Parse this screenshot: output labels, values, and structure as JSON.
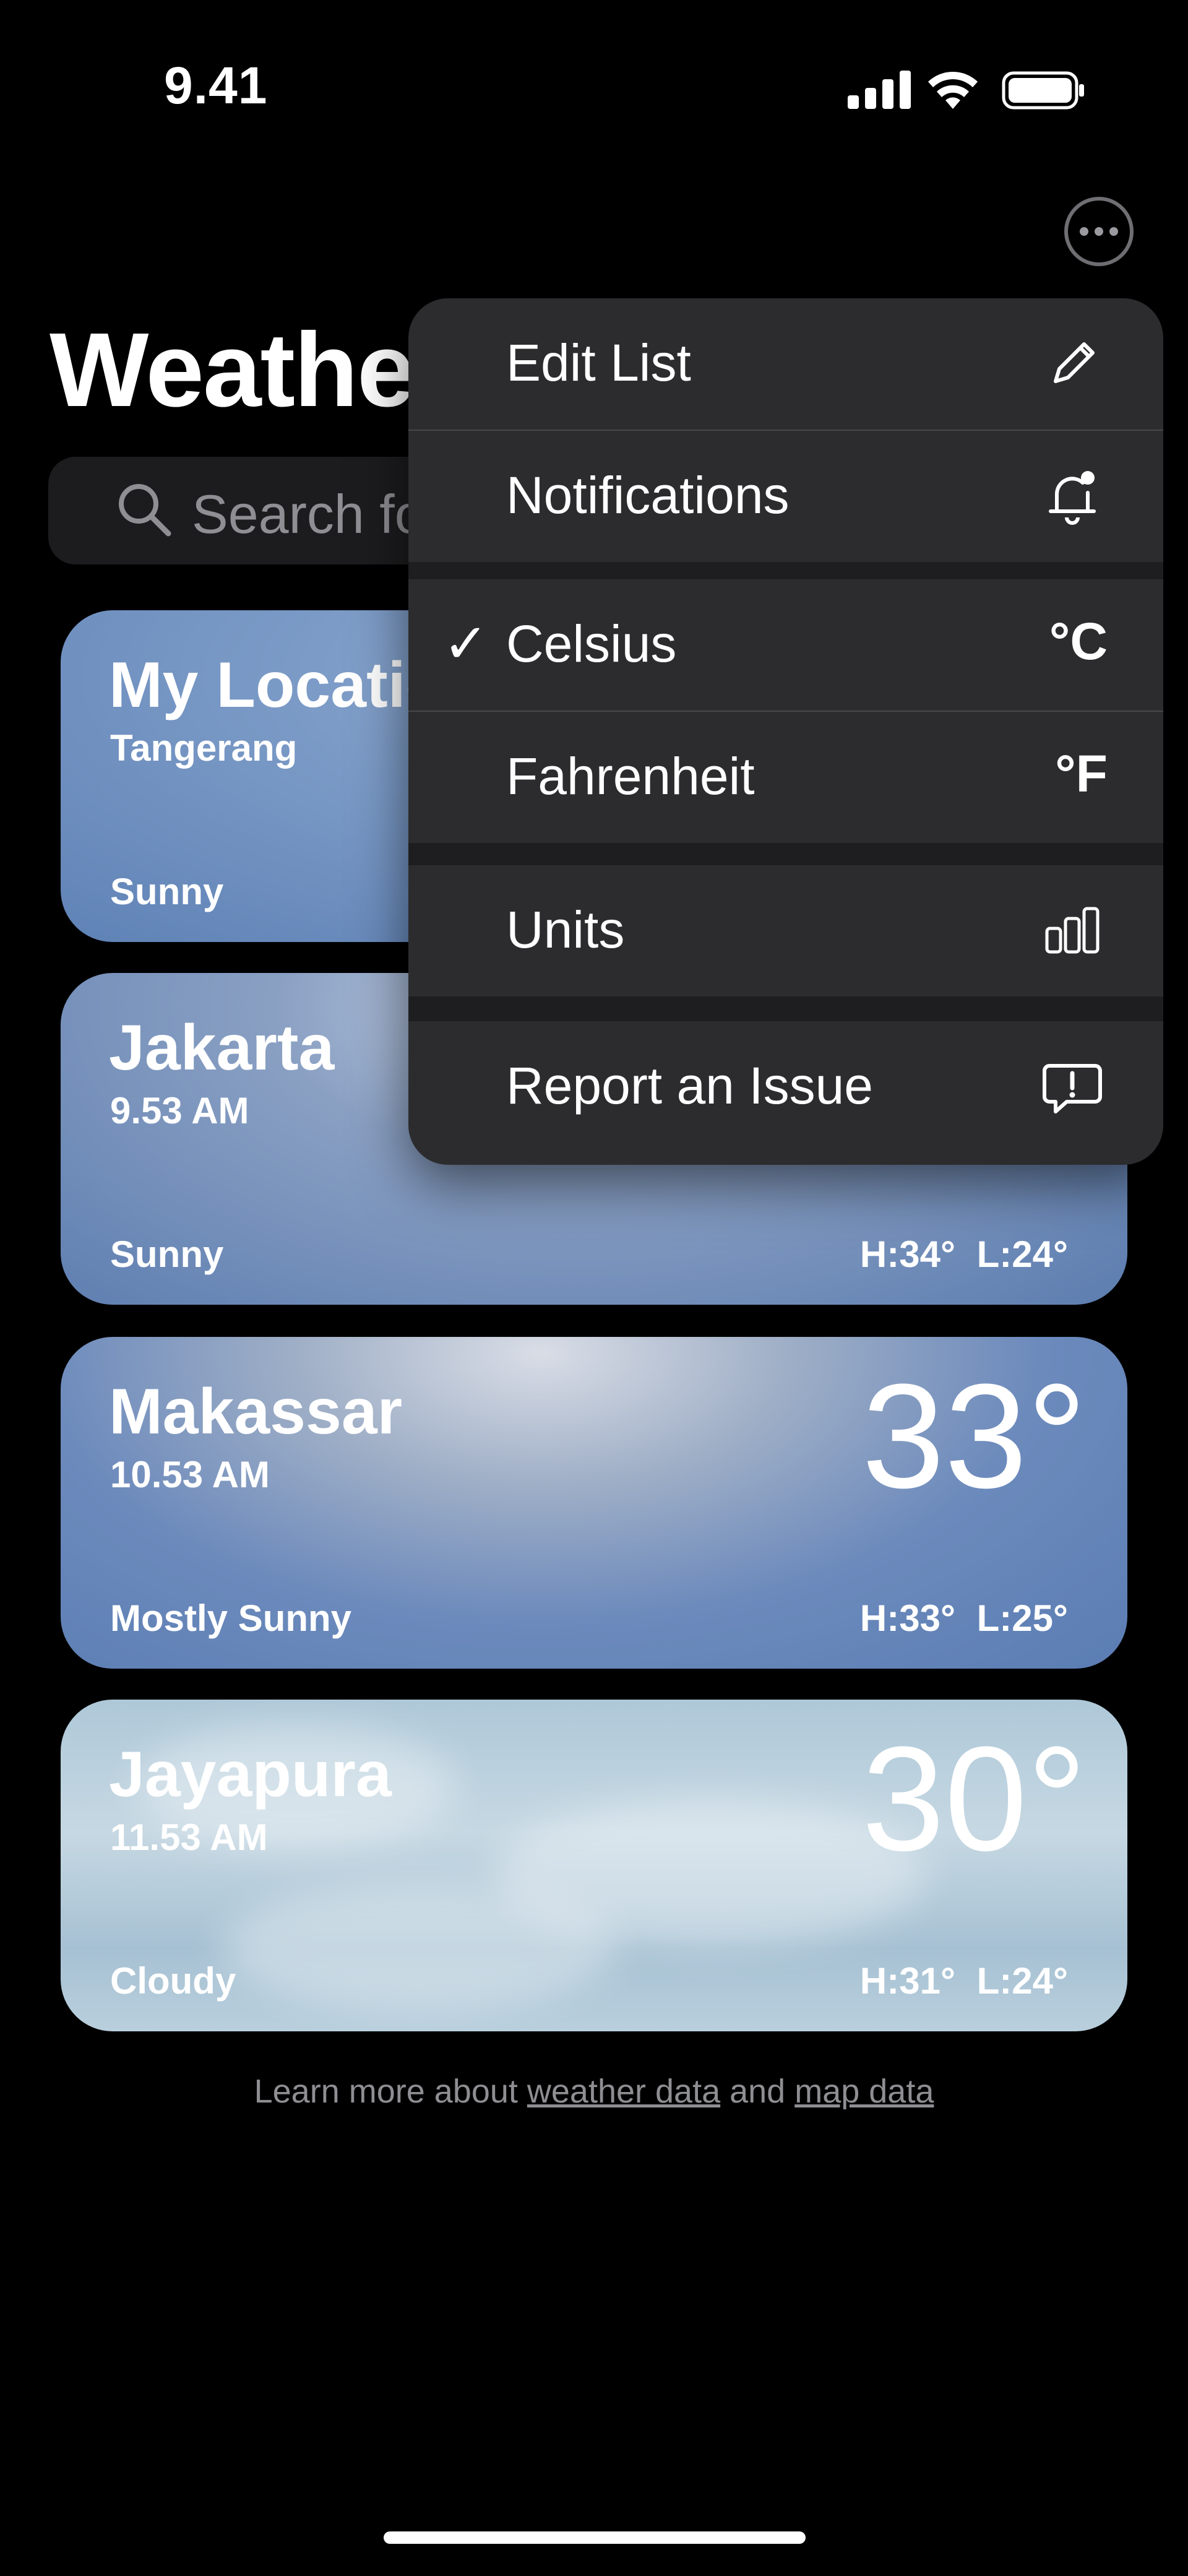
{
  "status_bar": {
    "time": "9.41"
  },
  "header": {
    "title": "Weather"
  },
  "search": {
    "placeholder": "Search for a city or airport"
  },
  "cards": [
    {
      "city": "My Location",
      "subtitle": "Tangerang",
      "condition": "Sunny",
      "temp": "",
      "high_low": ""
    },
    {
      "city": "Jakarta",
      "subtitle": "9.53 AM",
      "condition": "Sunny",
      "temp": "",
      "high_low": "H:34° L:24°"
    },
    {
      "city": "Makassar",
      "subtitle": "10.53 AM",
      "condition": "Mostly Sunny",
      "temp": "33°",
      "high_low": "H:33° L:25°"
    },
    {
      "city": "Jayapura",
      "subtitle": "11.53 AM",
      "condition": "Cloudy",
      "temp": "30°",
      "high_low": "H:31° L:24°"
    }
  ],
  "footer": {
    "prefix": "Learn more about ",
    "link1": "weather data",
    "mid": " and ",
    "link2": "map data"
  },
  "menu": {
    "edit_list": "Edit List",
    "notifications": "Notifications",
    "celsius": "Celsius",
    "celsius_unit": "°C",
    "celsius_checked": true,
    "check_mark": "✓",
    "fahrenheit": "Fahrenheit",
    "fahrenheit_unit": "°F",
    "units": "Units",
    "report_issue": "Report an Issue",
    "icons": {
      "edit_list": "pencil-icon",
      "notifications": "bell-badge-icon",
      "units": "bar-chart-icon",
      "report_issue": "exclamation-bubble-icon"
    }
  }
}
